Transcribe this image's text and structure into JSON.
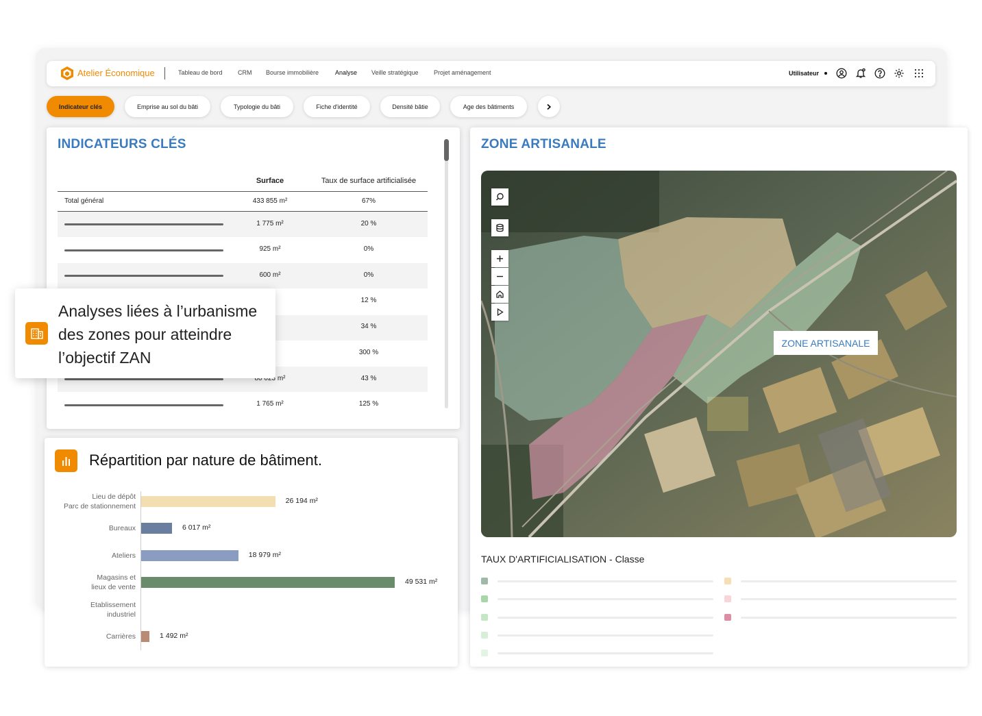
{
  "brand": {
    "name": "Atelier Économique",
    "accent": "#f08a00",
    "title_blue": "#3a7bbf"
  },
  "nav": {
    "items": [
      "Tableau de bord",
      "CRM",
      "Bourse immobilière",
      "Analyse",
      "Veille stratégique",
      "Projet aménagement"
    ],
    "active": "Analyse",
    "user_label": "Utilisateur",
    "icons": [
      "user-circle-icon",
      "bell-icon",
      "help-icon",
      "gear-icon",
      "apps-grid-icon"
    ]
  },
  "chips": {
    "items": [
      "Indicateur clés",
      "Emprise au sol du bâti",
      "Typologie du bâti",
      "Fiche d'identité",
      "Densité bâtie",
      "Age des bâtiments"
    ],
    "active": "Indicateur clés",
    "next_icon": "chevron-right-icon"
  },
  "indicators": {
    "title": "INDICATEURS CLÉS",
    "columns": [
      "Surface",
      "Taux de surface artificialisée"
    ],
    "total": {
      "label": "Total général",
      "surface": "433 855 m²",
      "rate": "67%"
    },
    "rows": [
      {
        "surface": "1 775 m²",
        "rate": "20 %"
      },
      {
        "surface": "925 m²",
        "rate": "0%"
      },
      {
        "surface": "600 m²",
        "rate": "0%"
      },
      {
        "surface": "m²",
        "rate": "12 %"
      },
      {
        "surface": "²",
        "rate": "34 %"
      },
      {
        "surface": "m²",
        "rate": "300 %"
      },
      {
        "surface": "80 023 m²",
        "rate": "43 %"
      },
      {
        "surface": "1 765 m²",
        "rate": "125 %"
      }
    ]
  },
  "overlay": {
    "text": "Analyses liées à l’urbanisme des zones pour atteindre l’objectif ZAN",
    "icon": "building-icon"
  },
  "chart": {
    "title": "Répartition par nature de bâtiment.",
    "icon": "bar-chart-icon"
  },
  "chart_data": {
    "type": "bar",
    "orientation": "horizontal",
    "categories": [
      "Lieu de dépôt\nParc de stationnement",
      "Bureaux",
      "Ateliers",
      "Magasins et\nlieux de vente",
      "Etablissement\nindustriel",
      "Carrières"
    ],
    "values": [
      26194,
      6017,
      18979,
      49531,
      null,
      1492
    ],
    "value_labels": [
      "26 194 m²",
      "6 017 m²",
      "18 979 m²",
      "49 531 m²",
      "",
      "1 492 m²"
    ],
    "colors": [
      "#f3deb2",
      "#6a7fa0",
      "#8b9cc3",
      "#6a8c6a",
      "#cccccc",
      "#b98a74"
    ],
    "xlim": [
      0,
      49531
    ],
    "grid": false
  },
  "map": {
    "title": "ZONE ARTISANALE",
    "zone_label": "ZONE ARTISANALE",
    "controls": [
      "search-icon",
      "layers-icon",
      "zoom-in-icon",
      "zoom-out-icon",
      "home-icon",
      "play-icon"
    ],
    "zone_colors": {
      "tan": "#f1d6a8",
      "green": "#bfe3c2",
      "teal": "#a9cbb9",
      "pink": "#e39bb3"
    }
  },
  "legend": {
    "title": "TAUX D'ARTIFICIALISATION - Classe",
    "left_colors": [
      "#9fb8a8",
      "#a8d6a8",
      "#c5e7c5",
      "#d6efd6",
      "#e2f4e2"
    ],
    "right_colors": [
      "#f6dfb5",
      "#f8d5d9",
      "#de8ea4"
    ]
  }
}
